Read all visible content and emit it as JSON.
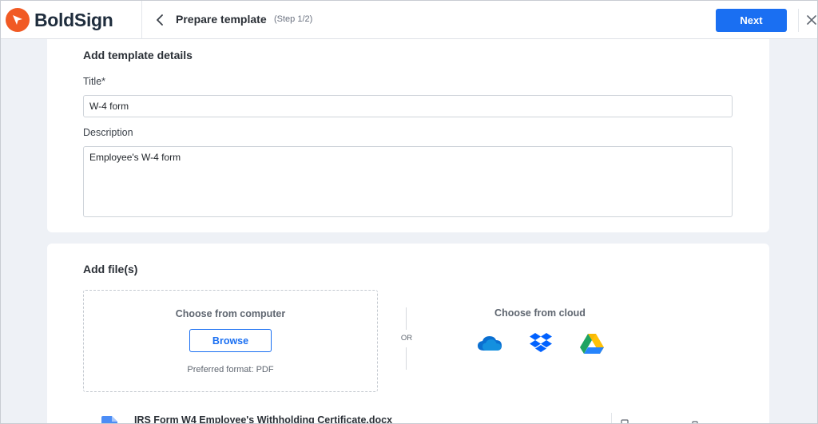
{
  "app": {
    "brand_name": "BoldSign",
    "brand_color": "#f15a24",
    "accent_color": "#1a6ff2"
  },
  "header": {
    "back_icon": "chevron-left-icon",
    "title": "Prepare template",
    "step": "(Step 1/2)",
    "next_label": "Next",
    "close_icon": "close-icon"
  },
  "details": {
    "section_title": "Add template details",
    "title_label": "Title*",
    "title_value": "W-4 form",
    "description_label": "Description",
    "description_value": "Employee's W-4 form"
  },
  "files": {
    "section_title": "Add file(s)",
    "computer": {
      "title": "Choose from computer",
      "browse_label": "Browse",
      "preferred_format": "Preferred format: PDF"
    },
    "or_label": "OR",
    "cloud": {
      "title": "Choose from cloud",
      "providers": [
        "onedrive-icon",
        "dropbox-icon",
        "google-drive-icon"
      ]
    },
    "uploaded": [
      {
        "name": "IRS Form W4 Employee's Withholding Certificate.docx"
      }
    ]
  }
}
